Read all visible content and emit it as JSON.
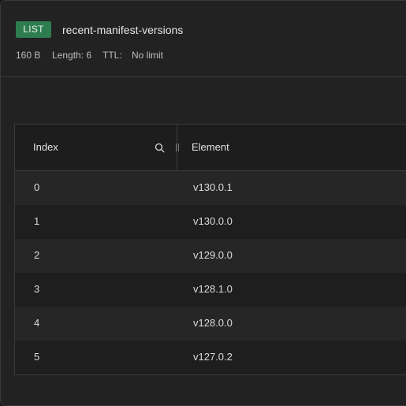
{
  "key": {
    "type_badge": "LIST",
    "name": "recent-manifest-versions",
    "size": "160 B",
    "length": "Length: 6",
    "ttl_label": "TTL:",
    "ttl_value": "No limit",
    "badge_color": "#2e7d4f"
  },
  "table": {
    "columns": {
      "index": "Index",
      "element": "Element"
    },
    "icons": {
      "search": "search-icon",
      "resize": "column-resize-handle"
    },
    "rows": [
      {
        "index": "0",
        "element": "v130.0.1"
      },
      {
        "index": "1",
        "element": "v130.0.0"
      },
      {
        "index": "2",
        "element": "v129.0.0"
      },
      {
        "index": "3",
        "element": "v128.1.0"
      },
      {
        "index": "4",
        "element": "v128.0.0"
      },
      {
        "index": "5",
        "element": "v127.0.2"
      }
    ]
  }
}
